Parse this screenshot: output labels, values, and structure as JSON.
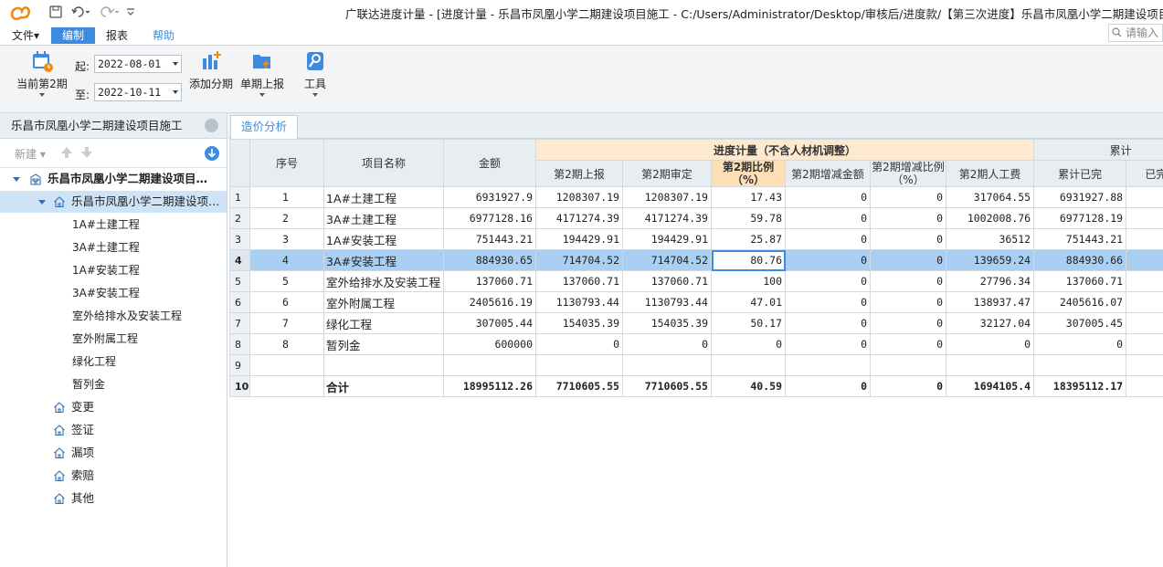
{
  "window": {
    "title": "广联达进度计量 - [进度计量 - 乐昌市凤凰小学二期建设项目施工 - C:/Users/Administrator/Desktop/审核后/进度款/【第三次进度】乐昌市凤凰小学二期建设项目施工."
  },
  "menu": {
    "file": "文件▾",
    "edit": "编制",
    "report": "报表",
    "help": "帮助",
    "search_placeholder": "请输入"
  },
  "ribbon": {
    "current_period": "当前第2期",
    "start_label": "起:",
    "start_date": "2022-08-01",
    "end_label": "至:",
    "end_date": "2022-10-11",
    "add_period": "添加分期",
    "single_report": "单期上报",
    "tools": "工具"
  },
  "left_panel": {
    "title": "乐昌市凤凰小学二期建设项目施工",
    "new_label": "新建",
    "tree": [
      {
        "label": "乐昌市凤凰小学二期建设项目…",
        "level": 0,
        "icon": "building-icon",
        "expand": true,
        "bold": true
      },
      {
        "label": "乐昌市凤凰小学二期建设项…",
        "level": 1,
        "icon": "home-icon",
        "expand": true,
        "selected": true
      },
      {
        "label": "1A#土建工程",
        "level": 2
      },
      {
        "label": "3A#土建工程",
        "level": 2
      },
      {
        "label": "1A#安装工程",
        "level": 2
      },
      {
        "label": "3A#安装工程",
        "level": 2
      },
      {
        "label": "室外给排水及安装工程",
        "level": 2
      },
      {
        "label": "室外附属工程",
        "level": 2
      },
      {
        "label": "绿化工程",
        "level": 2
      },
      {
        "label": "暂列金",
        "level": 2
      },
      {
        "label": "变更",
        "level": 1,
        "icon": "home-icon"
      },
      {
        "label": "签证",
        "level": 1,
        "icon": "home-icon"
      },
      {
        "label": "漏项",
        "level": 1,
        "icon": "home-icon"
      },
      {
        "label": "索赔",
        "level": 1,
        "icon": "home-icon"
      },
      {
        "label": "其他",
        "level": 1,
        "icon": "home-icon"
      }
    ]
  },
  "tabs": {
    "cost_analysis": "造价分析"
  },
  "table": {
    "group_header": "进度计量（不含人材机调整）",
    "cumulative_header": "累计",
    "headers": {
      "seq": "序号",
      "name": "项目名称",
      "amount": "金额",
      "reported": "第2期上报",
      "approved": "第2期审定",
      "ratio": "第2期比例（%）",
      "change_amount": "第2期增减金额",
      "change_ratio": "第2期增减比例（%）",
      "labor": "第2期人工费",
      "cum_done": "累计已完",
      "cum_ratio": "已完（%"
    },
    "rows": [
      {
        "rn": "1",
        "seq": "1",
        "name": "1A#土建工程",
        "amount": "6931927.9",
        "reported": "1208307.19",
        "approved": "1208307.19",
        "ratio": "17.43",
        "change_amount": "0",
        "change_ratio": "0",
        "labor": "317064.55",
        "cum_done": "6931927.88"
      },
      {
        "rn": "2",
        "seq": "2",
        "name": "3A#土建工程",
        "amount": "6977128.16",
        "reported": "4171274.39",
        "approved": "4171274.39",
        "ratio": "59.78",
        "change_amount": "0",
        "change_ratio": "0",
        "labor": "1002008.76",
        "cum_done": "6977128.19"
      },
      {
        "rn": "3",
        "seq": "3",
        "name": "1A#安装工程",
        "amount": "751443.21",
        "reported": "194429.91",
        "approved": "194429.91",
        "ratio": "25.87",
        "change_amount": "0",
        "change_ratio": "0",
        "labor": "36512",
        "cum_done": "751443.21"
      },
      {
        "rn": "4",
        "seq": "4",
        "name": "3A#安装工程",
        "amount": "884930.65",
        "reported": "714704.52",
        "approved": "714704.52",
        "ratio": "80.76",
        "change_amount": "0",
        "change_ratio": "0",
        "labor": "139659.24",
        "cum_done": "884930.66",
        "selected": true
      },
      {
        "rn": "5",
        "seq": "5",
        "name": "室外给排水及安装工程",
        "amount": "137060.71",
        "reported": "137060.71",
        "approved": "137060.71",
        "ratio": "100",
        "change_amount": "0",
        "change_ratio": "0",
        "labor": "27796.34",
        "cum_done": "137060.71"
      },
      {
        "rn": "6",
        "seq": "6",
        "name": "室外附属工程",
        "amount": "2405616.19",
        "reported": "1130793.44",
        "approved": "1130793.44",
        "ratio": "47.01",
        "change_amount": "0",
        "change_ratio": "0",
        "labor": "138937.47",
        "cum_done": "2405616.07"
      },
      {
        "rn": "7",
        "seq": "7",
        "name": "绿化工程",
        "amount": "307005.44",
        "reported": "154035.39",
        "approved": "154035.39",
        "ratio": "50.17",
        "change_amount": "0",
        "change_ratio": "0",
        "labor": "32127.04",
        "cum_done": "307005.45"
      },
      {
        "rn": "8",
        "seq": "8",
        "name": "暂列金",
        "amount": "600000",
        "reported": "0",
        "approved": "0",
        "ratio": "0",
        "change_amount": "0",
        "change_ratio": "0",
        "labor": "0",
        "cum_done": "0"
      },
      {
        "rn": "9",
        "seq": "",
        "name": "",
        "amount": "",
        "reported": "",
        "approved": "",
        "ratio": "",
        "change_amount": "",
        "change_ratio": "",
        "labor": "",
        "cum_done": ""
      },
      {
        "rn": "10",
        "seq": "",
        "name": "合计",
        "amount": "18995112.26",
        "reported": "7710605.55",
        "approved": "7710605.55",
        "ratio": "40.59",
        "change_amount": "0",
        "change_ratio": "0",
        "labor": "1694105.4",
        "cum_done": "18395112.17",
        "total": true
      }
    ]
  },
  "colors": {
    "accent": "#3d8be0",
    "selected_row": "#a9cff2",
    "group_header": "#fde9cf"
  }
}
